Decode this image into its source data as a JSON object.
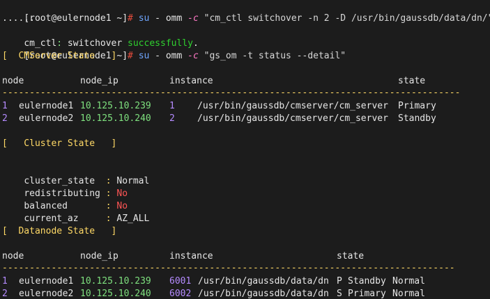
{
  "colors": {
    "background": "#1c1c1c",
    "prompt_hash": "#e74c3c",
    "command_su": "#6fa6ff",
    "success_green": "#2fd12f",
    "ip_green": "#7ee07e",
    "bad_red": "#ff5555",
    "separator_yellow": "#ffd966",
    "instance_purple": "#b58bff"
  },
  "prompt": {
    "user_host": "[root@eulernode1 ~]",
    "hash": "#"
  },
  "command1": {
    "su": "su",
    "dash": "-",
    "user": "omm",
    "flag": "-c",
    "arg": "\"cm_ctl switchover -n 2 -D /usr/bin/gaussdb/data/dn/\""
  },
  "output_dots": "......",
  "switchover": {
    "prefix": "cm_ctl",
    "colon": ":",
    "text": " switchover ",
    "status": "successfully",
    "end": "."
  },
  "command2": {
    "su": "su",
    "dash": "-",
    "user": "omm",
    "flag": "-c",
    "arg": "\"gs_om -t status --detail\""
  },
  "cmserver": {
    "title": "[  CMServer State   ]",
    "headers": [
      "node",
      "node_ip",
      "instance",
      "state"
    ],
    "separator": "------------------------------------------------------------------------------------",
    "rows": [
      {
        "num": "1",
        "node": "eulernode1",
        "ip": "10.125.10.239",
        "id": "1",
        "path": "/usr/bin/gaussdb/cmserver/cm_server",
        "state": "Primary"
      },
      {
        "num": "2",
        "node": "eulernode2",
        "ip": "10.125.10.240",
        "id": "2",
        "path": "/usr/bin/gaussdb/cmserver/cm_server",
        "state": "Standby"
      }
    ]
  },
  "cluster": {
    "title": "[   Cluster State   ]",
    "fields": [
      {
        "key": "cluster_state  ",
        "sep": ":",
        "value": " Normal",
        "color": "normal"
      },
      {
        "key": "redistributing ",
        "sep": ":",
        "value": " No",
        "color": "red"
      },
      {
        "key": "balanced       ",
        "sep": ":",
        "value": " No",
        "color": "red"
      },
      {
        "key": "current_az     ",
        "sep": ":",
        "value": " AZ_ALL",
        "color": "normal"
      }
    ]
  },
  "datanode": {
    "title": "[  Datanode State   ]",
    "headers": [
      "node",
      "node_ip",
      "instance",
      "state"
    ],
    "separator": "-----------------------------------------------------------------------------------",
    "rows": [
      {
        "num": "1",
        "node": "eulernode1",
        "ip": "10.125.10.239",
        "id": "6001",
        "path": "/usr/bin/gaussdb/data/dn",
        "role": "P",
        "state": "Standby",
        "status": "Normal"
      },
      {
        "num": "2",
        "node": "eulernode2",
        "ip": "10.125.10.240",
        "id": "6002",
        "path": "/usr/bin/gaussdb/data/dn",
        "role": "S",
        "state": "Primary",
        "status": "Normal"
      }
    ]
  }
}
